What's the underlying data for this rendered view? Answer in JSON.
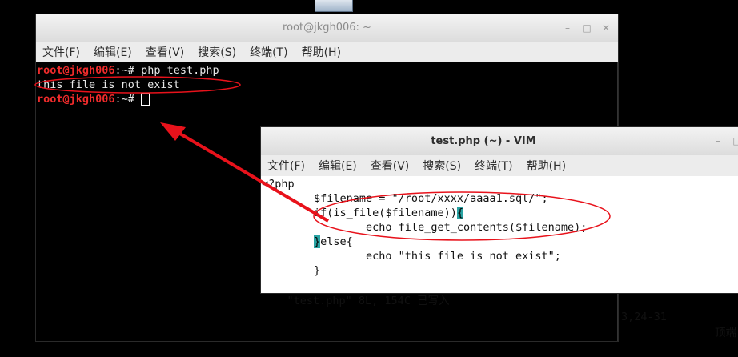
{
  "terminal": {
    "title": "root@jkgh006: ~",
    "menu": [
      "文件(F)",
      "编辑(E)",
      "查看(V)",
      "搜索(S)",
      "终端(T)",
      "帮助(H)"
    ],
    "lines": [
      {
        "prompt": "root@jkgh006",
        "suffix": ":~# ",
        "command": "php test.php"
      },
      {
        "text": "this file is not exist"
      },
      {
        "prompt": "root@jkgh006",
        "suffix": ":~# ",
        "command": ""
      }
    ]
  },
  "vim": {
    "title": "test.php (~) - VIM",
    "menu": [
      "文件(F)",
      "编辑(E)",
      "查看(V)",
      "搜索(S)",
      "终端(T)",
      "帮助(H)"
    ],
    "code": [
      "<?php",
      "        $filename = \"/root/xxxx/aaaa1.sql/\";",
      "        if(is_file($filename)){",
      "                echo file_get_contents($filename);",
      "        }else{",
      "                echo \"this file is not exist\";",
      "        }"
    ],
    "status_left": "\"test.php\" 8L, 154C 已写入",
    "status_pos": "3,24-31",
    "status_right": "顶端"
  },
  "window_controls": [
    "–",
    "□",
    "✕"
  ],
  "colors": {
    "prompt": "#ef2b2b",
    "annotation": "#e8121b",
    "cursor_highlight": "#29a3a3"
  }
}
